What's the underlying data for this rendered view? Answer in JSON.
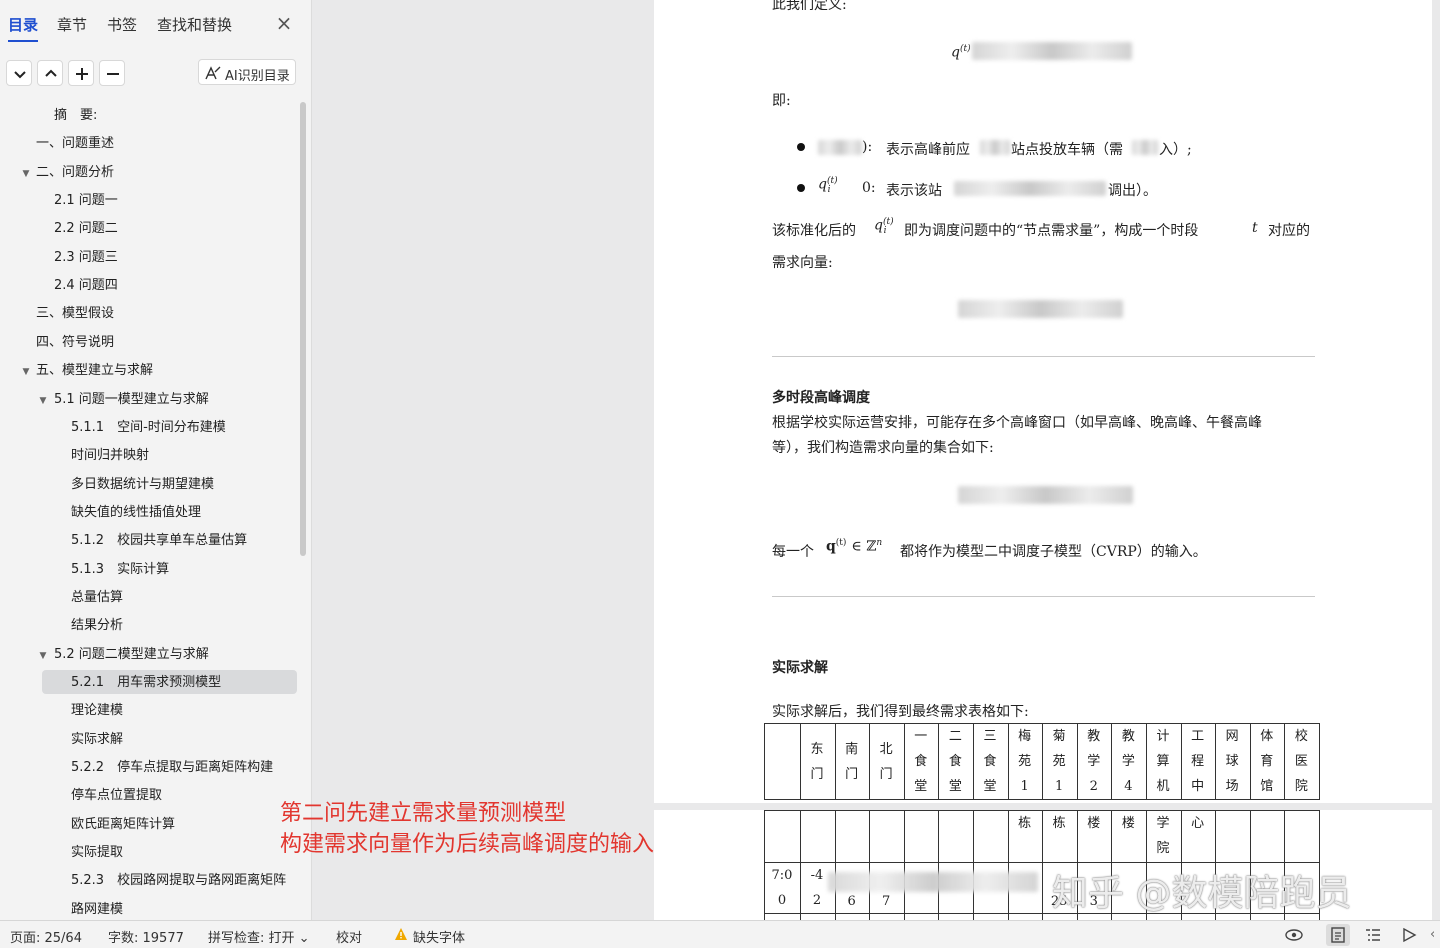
{
  "sidebar": {
    "tabs": [
      {
        "label": "目录",
        "active": true
      },
      {
        "label": "章节",
        "active": false
      },
      {
        "label": "书签",
        "active": false
      },
      {
        "label": "查找和替换",
        "active": false
      }
    ],
    "close_icon": "close-icon",
    "toolbar": {
      "expand_icon": "chevron-down-icon",
      "collapse_icon": "chevron-up-icon",
      "add_icon": "plus-icon",
      "remove_icon": "minus-icon",
      "ai_label": "AI识别目录"
    },
    "toc": [
      {
        "text": "摘　要:",
        "level": 1,
        "arrow": ""
      },
      {
        "text": "一、问题重述",
        "level": 0,
        "arrow": ""
      },
      {
        "text": "二、问题分析",
        "level": 0,
        "arrow": "▼"
      },
      {
        "text": "2.1 问题一",
        "level": 1,
        "arrow": ""
      },
      {
        "text": "2.2 问题二",
        "level": 1,
        "arrow": ""
      },
      {
        "text": "2.3 问题三",
        "level": 1,
        "arrow": ""
      },
      {
        "text": "2.4 问题四",
        "level": 1,
        "arrow": ""
      },
      {
        "text": "三、模型假设",
        "level": 0,
        "arrow": ""
      },
      {
        "text": "四、符号说明",
        "level": 0,
        "arrow": ""
      },
      {
        "text": "五、模型建立与求解",
        "level": 0,
        "arrow": "▼"
      },
      {
        "text": "5.1 问题一模型建立与求解",
        "level": 1,
        "arrow": "▼"
      },
      {
        "text": "5.1.1　空间-时间分布建模",
        "level": 2,
        "arrow": ""
      },
      {
        "text": "时间归并映射",
        "level": 2,
        "arrow": ""
      },
      {
        "text": "多日数据统计与期望建模",
        "level": 2,
        "arrow": ""
      },
      {
        "text": "缺失值的线性插值处理",
        "level": 2,
        "arrow": ""
      },
      {
        "text": "5.1.2　校园共享单车总量估算",
        "level": 2,
        "arrow": ""
      },
      {
        "text": "5.1.3　实际计算",
        "level": 2,
        "arrow": ""
      },
      {
        "text": "总量估算",
        "level": 2,
        "arrow": ""
      },
      {
        "text": "结果分析",
        "level": 2,
        "arrow": ""
      },
      {
        "text": "5.2 问题二模型建立与求解",
        "level": 1,
        "arrow": "▼"
      },
      {
        "text": "5.2.1　用车需求预测模型",
        "level": 2,
        "arrow": "",
        "selected": true
      },
      {
        "text": "理论建模",
        "level": 2,
        "arrow": ""
      },
      {
        "text": "实际求解",
        "level": 2,
        "arrow": ""
      },
      {
        "text": "5.2.2　停车点提取与距离矩阵构建",
        "level": 2,
        "arrow": ""
      },
      {
        "text": "停车点位置提取",
        "level": 2,
        "arrow": ""
      },
      {
        "text": "欧氏距离矩阵计算",
        "level": 2,
        "arrow": ""
      },
      {
        "text": "实际提取",
        "level": 2,
        "arrow": ""
      },
      {
        "text": "5.2.3　校园路网提取与路网距离矩阵",
        "level": 2,
        "arrow": ""
      },
      {
        "text": "路网建模",
        "level": 2,
        "arrow": ""
      }
    ]
  },
  "annotation": {
    "line1": "第二问先建立需求量预测模型",
    "line2": "构建需求向量作为后续高峰调度的输入",
    "color": "#e2362f"
  },
  "document": {
    "top_cut": "此我们定义:",
    "formula1_var": "q",
    "formula1_sup": "(t)",
    "ji": "即:",
    "bullet1_a": "):",
    "bullet1_b": "表示高峰前应",
    "bullet1_c": "站点投放车辆（需",
    "bullet1_d": "入）;",
    "bullet2_var": "q",
    "bullet2_sup": "(t)",
    "bullet2_sub": "i",
    "bullet2_a": "0:",
    "bullet2_b": "表示该站",
    "bullet2_c": "调出）。",
    "para1_a": "该标准化后的",
    "para1_var": "q",
    "para1_sup": "(t)",
    "para1_sub": "i",
    "para1_b": "即为调度问题中的“节点需求量”，构成一个时段",
    "para1_t": "t",
    "para1_c": "对应的",
    "para1_line2": "需求向量:",
    "heading1": "多时段高峰调度",
    "para2_line1": "根据学校实际运营安排，可能存在多个高峰窗口（如早高峰、晚高峰、午餐高峰",
    "para2_line2": "等），我们构造需求向量的集合如下:",
    "para3_a": "每一个",
    "para3_formula": "q",
    "para3_sup": "(t)",
    "para3_in": "∈ ℤ",
    "para3_n": "n",
    "para3_b": "都将作为模型二中调度子模型（CVRP）的输入。",
    "heading2": "实际求解",
    "para4": "实际求解后，我们得到最终需求表格如下:",
    "table_headers": [
      "东门",
      "南门",
      "北门",
      "一食堂",
      "二食堂",
      "三食堂",
      "梅苑1",
      "菊苑1",
      "教学2",
      "教学4",
      "计算机",
      "工程中",
      "网球场",
      "体育馆",
      "校医院"
    ],
    "table_cont": [
      "",
      "",
      "",
      "",
      "",
      "",
      "栋",
      "栋",
      "楼",
      "楼",
      "学院",
      "心",
      "",
      "",
      ""
    ],
    "table_row1": [
      "7:00",
      "-4 2",
      "6",
      "7",
      "",
      "",
      "",
      "",
      "25",
      "3",
      "",
      "",
      "",
      "",
      ""
    ]
  },
  "watermark": "知乎 @数模陪跑员",
  "status": {
    "page": "页面: 25/64",
    "words": "字数: 19577",
    "spell": "拼写检查: 打开",
    "proof": "校对",
    "missing_font": "缺失字体",
    "icons": [
      "eye-icon",
      "page-view-icon",
      "outline-view-icon",
      "play-icon"
    ]
  }
}
